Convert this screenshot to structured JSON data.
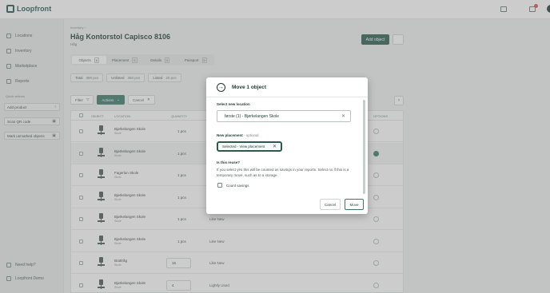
{
  "app": {
    "logo_text": "Loopfront"
  },
  "sidebar": {
    "items": [
      {
        "label": "Locations",
        "icon": "location-icon"
      },
      {
        "label": "Inventory",
        "icon": "inventory-icon"
      },
      {
        "label": "Marketplace",
        "icon": "marketplace-icon"
      },
      {
        "label": "Reports",
        "icon": "reports-icon"
      }
    ],
    "quick_actions_head": "Quick actions",
    "buttons": [
      {
        "label": "Add product",
        "right": "›"
      },
      {
        "label": "Scan QR code",
        "right": "▣"
      },
      {
        "label": "Mark unmarked objects",
        "right": "▣"
      }
    ],
    "footer": [
      {
        "label": "Need help?",
        "icon": "help-icon"
      },
      {
        "label": "Loopfront Demo",
        "icon": "settings-icon"
      }
    ]
  },
  "main": {
    "breadcrumb": "Inventory  ›",
    "title": "Håg Kontorstol Capisco 8106",
    "subtitle": "Håg",
    "add_object_label": "Add object",
    "tabs": [
      {
        "label": "Objects",
        "count": "8"
      },
      {
        "label": "Placement",
        "count": "0"
      },
      {
        "label": "Details",
        "count": "0"
      },
      {
        "label": "Passport",
        "count": "0"
      }
    ],
    "stats": [
      {
        "label": "Total",
        "value": "380 pcs"
      },
      {
        "label": "Unlisted",
        "value": "360 pcs"
      },
      {
        "label": "Listed",
        "value": "20 pcs"
      }
    ],
    "toolbar": {
      "filter": "Filter",
      "actions": "Actions",
      "cancel": "Cancel"
    },
    "pager_next": "›",
    "table": {
      "headers": [
        "OBJECT",
        "LOCATION",
        "QUANTITY",
        "OPTIONS"
      ],
      "rows": [
        {
          "location": "Bjørkelangen Skole",
          "sub": "Skole",
          "qty": "1 pcs",
          "cond": ""
        },
        {
          "location": "Bjørkelangen Skole",
          "sub": "Skole",
          "qty": "1 pcs",
          "cond": ""
        },
        {
          "location": "Fagerlun Skole",
          "sub": "Skole",
          "qty": "1 pcs",
          "cond": ""
        },
        {
          "location": "Bjørkelangen Skole",
          "sub": "Skole",
          "qty": "1 pcs",
          "cond": ""
        },
        {
          "location": "Bjørkelangen Skole",
          "sub": "Skole",
          "qty": "1 pcs",
          "cond": "Like New"
        },
        {
          "location": "Bjørkelangen Skole",
          "sub": "Skole",
          "qty": "1 pcs",
          "cond": "Like New"
        },
        {
          "location": "Brattråg",
          "sub": "Skole",
          "qty": "15",
          "cond": "Like New"
        },
        {
          "location": "Bjørkelangen Skole",
          "sub": "Skole",
          "qty": "4",
          "cond": "Lightly Used"
        }
      ]
    }
  },
  "modal": {
    "title": "Move 1 object",
    "select_location_label": "Select new location",
    "location_value": "første (1) - Bjørkelangen Skole",
    "new_placement_label": "New placement",
    "optional": "- optional",
    "placement_value": "Selected - View placement",
    "reuse_label": "Is this reuse?",
    "reuse_text": "If you select yes this will be counted as savings in your reports. Select no if this is a temporary move, such as to a storage.",
    "count_savings_label": "Count savings",
    "cancel_label": "Cancel",
    "move_label": "Move"
  }
}
